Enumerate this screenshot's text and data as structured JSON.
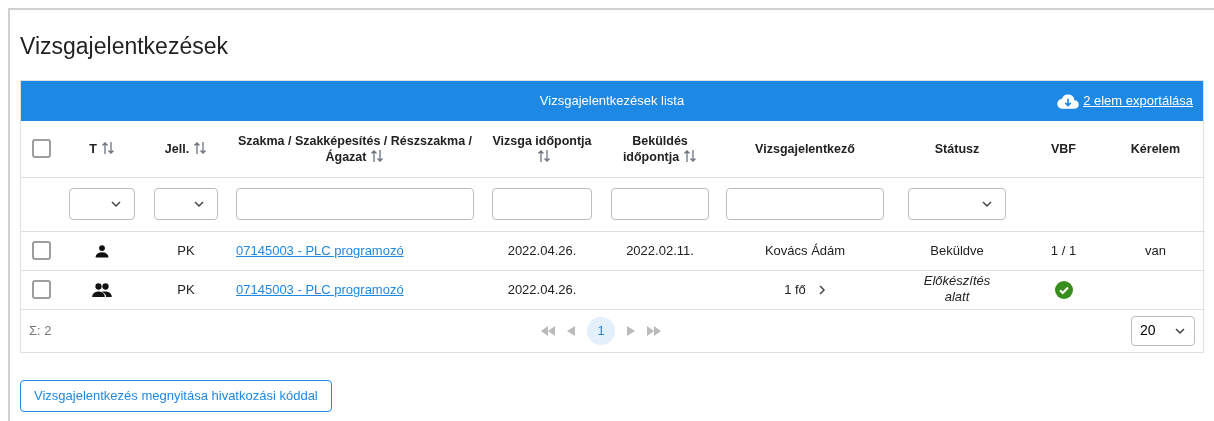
{
  "page": {
    "title": "Vizsgajelentkezések"
  },
  "table": {
    "title": "Vizsgajelentkezések lista",
    "export_link": "2 elem exportálása",
    "select_all": {
      "checked": false
    },
    "columns": [
      {
        "label": "T",
        "sortable": true,
        "filter": {
          "kind": "select"
        }
      },
      {
        "label": "Jell.",
        "sortable": true,
        "filter": {
          "kind": "select"
        }
      },
      {
        "label": "Szakma / Szakképesítés / Részszakma / Ágazat",
        "sortable": true,
        "filter": {
          "kind": "text"
        }
      },
      {
        "label": "Vizsga időpontja",
        "sortable": true,
        "filter": {
          "kind": "text"
        }
      },
      {
        "label": "Beküldés időpontja",
        "sortable": true,
        "filter": {
          "kind": "text"
        }
      },
      {
        "label": "Vizsgajelentkező",
        "sortable": false,
        "filter": {
          "kind": "text"
        }
      },
      {
        "label": "Státusz",
        "sortable": false,
        "filter": {
          "kind": "select"
        }
      },
      {
        "label": "VBF",
        "sortable": false
      },
      {
        "label": "Kérelem",
        "sortable": false
      }
    ],
    "rows": [
      {
        "checked": false,
        "kind": "single",
        "jell": "PK",
        "szakma": "07145003 - PLC programozó",
        "vizsga": "2022.04.26.",
        "bekuldes": "2022.02.11.",
        "jelentkezo": "Kovács Ádám",
        "expandable": false,
        "status": {
          "kind": "final",
          "text": "Beküldve"
        },
        "vbf": {
          "kind": "text",
          "text": "1 / 1"
        },
        "kerelem": "van"
      },
      {
        "checked": false,
        "kind": "group",
        "jell": "PK",
        "szakma": "07145003 - PLC programozó",
        "vizsga": "2022.04.26.",
        "jelentkezo": "1 fő",
        "expandable": true,
        "status": {
          "kind": "pending",
          "text": "Előkészítés alatt"
        },
        "vbf": {
          "kind": "ok"
        }
      }
    ],
    "footer": {
      "total": "Σ: 2",
      "pages": [
        {
          "label": "1",
          "selected": true
        }
      ],
      "page_size": "20"
    }
  },
  "actions": [
    {
      "label": "Vizsgajelentkezés megnyitása hivatkozási kóddal"
    }
  ]
}
